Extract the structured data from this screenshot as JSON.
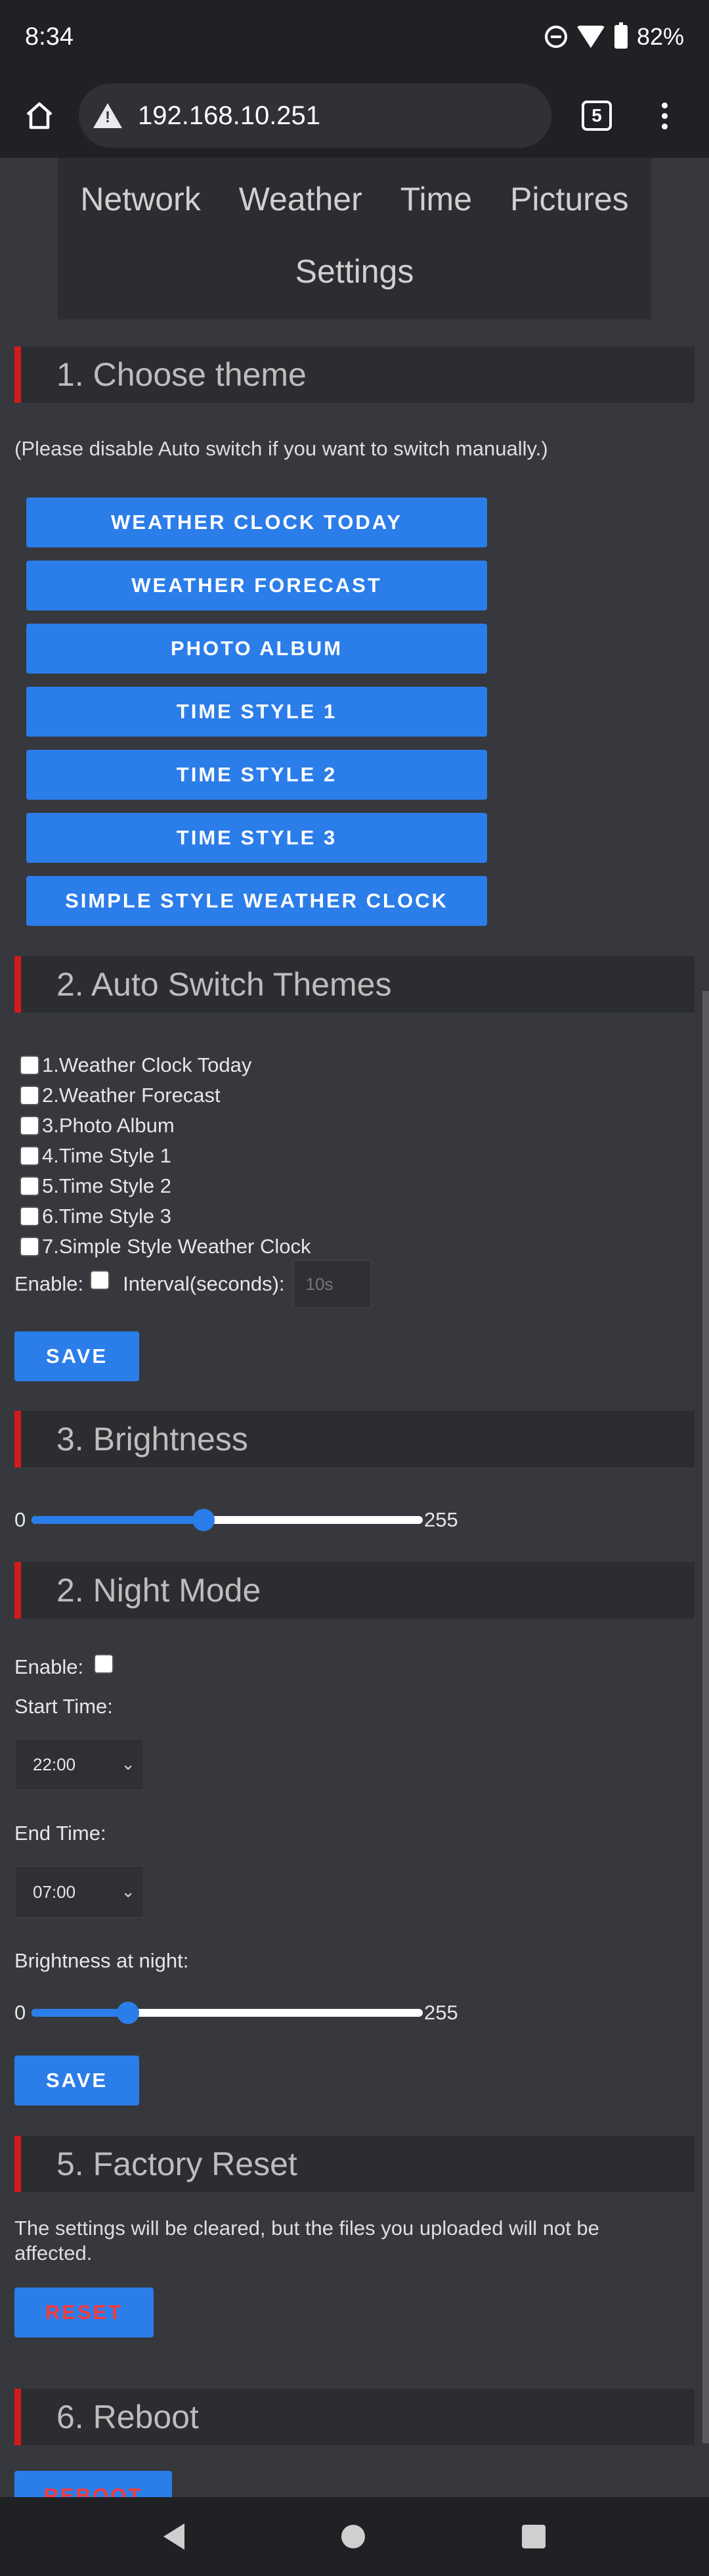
{
  "status_bar": {
    "time": "8:34",
    "battery": "82%"
  },
  "browser": {
    "url": "192.168.10.251",
    "tab_count": "5"
  },
  "nav": {
    "items": [
      "Network",
      "Weather",
      "Time",
      "Pictures",
      "Settings"
    ]
  },
  "theme_section": {
    "title": "1. Choose theme",
    "note": "(Please disable Auto switch if you want to switch manually.)",
    "buttons": [
      "WEATHER CLOCK TODAY",
      "WEATHER FORECAST",
      "PHOTO ALBUM",
      "TIME STYLE 1",
      "TIME STYLE 2",
      "TIME STYLE 3",
      "SIMPLE STYLE WEATHER CLOCK"
    ]
  },
  "auto_switch": {
    "title": "2. Auto Switch Themes",
    "themes": [
      "1.Weather Clock Today",
      "2.Weather Forecast",
      "3.Photo Album",
      "4.Time Style 1",
      "5.Time Style 2",
      "6.Time Style 3",
      "7.Simple Style Weather Clock"
    ],
    "enable_label": "Enable:",
    "interval_label": "Interval(seconds):",
    "interval_placeholder": "10s",
    "save_label": "SAVE"
  },
  "brightness": {
    "title": "3. Brightness",
    "min": "0",
    "max": "255",
    "value": 112
  },
  "night_mode": {
    "title": "2. Night Mode",
    "enable_label": "Enable:",
    "start_label": "Start Time:",
    "start_value": "22:00",
    "end_label": "End Time:",
    "end_value": "07:00",
    "brightness_label": "Brightness at night:",
    "min": "0",
    "max": "255",
    "value": 63,
    "save_label": "SAVE"
  },
  "factory_reset": {
    "title": "5. Factory Reset",
    "note": "The settings will be cleared, but the files you uploaded will not be affected.",
    "button_label": "RESET"
  },
  "reboot": {
    "title": "6. Reboot",
    "button_label": "REBOOT"
  },
  "colors": {
    "accent": "#2b7de9",
    "section_marker": "#d41a1a",
    "danger_text": "#ff3a3a",
    "background": "#36383d",
    "panel": "#2c2d31"
  }
}
